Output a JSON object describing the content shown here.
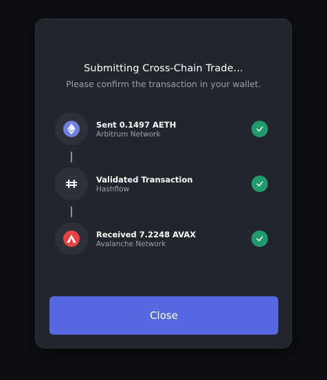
{
  "modal": {
    "title": "Submitting Cross-Chain Trade...",
    "subtitle": "Please confirm the transaction in your wallet.",
    "close_label": "Close"
  },
  "steps": [
    {
      "title": "Sent 0.1497 AETH",
      "subtitle": "Arbitrum Network",
      "icon": "ethereum-icon",
      "status": "complete"
    },
    {
      "title": "Validated Transaction",
      "subtitle": "Hashflow",
      "icon": "hashflow-icon",
      "status": "complete"
    },
    {
      "title": "Received 7.2248 AVAX",
      "subtitle": "Avalanche Network",
      "icon": "avalanche-icon",
      "status": "complete"
    }
  ],
  "colors": {
    "accent": "#5769e0",
    "success": "#1f9a6c",
    "modal_bg": "#22252c",
    "ethereum": "#6f7fe0",
    "avalanche": "#e84142"
  }
}
